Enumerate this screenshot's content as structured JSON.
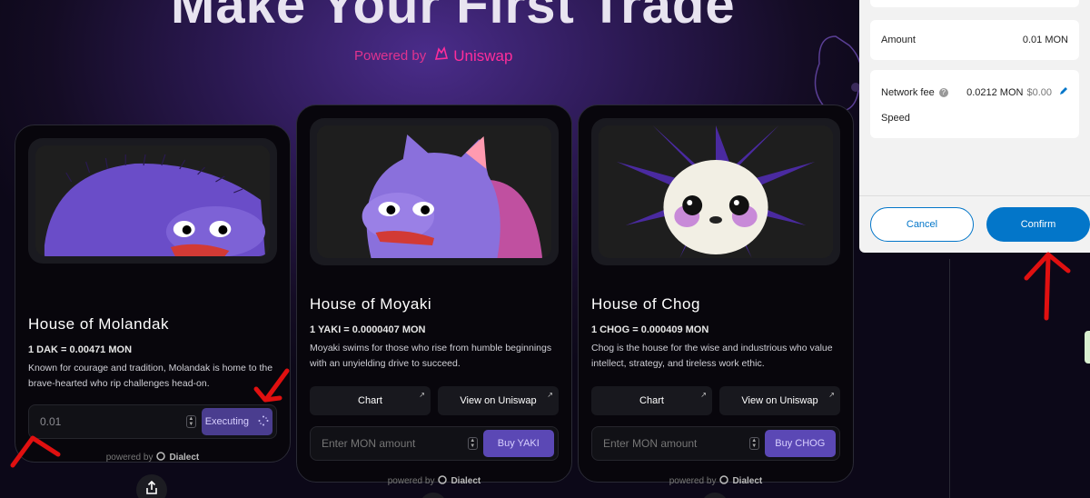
{
  "hero": {
    "title": "Make Your First Trade",
    "powered_prefix": "Powered by",
    "powered_brand": "Uniswap"
  },
  "cards": [
    {
      "name": "House of Molandak",
      "price": "1 DAK = 0.00471 MON",
      "description": "Known for courage and tradition, Molandak is home to the brave-hearted who rip challenges head-on.",
      "input_value": "0.01",
      "action_label": "Executing",
      "powered_prefix": "powered by",
      "powered_brand": "Dialect"
    },
    {
      "name": "House of Moyaki",
      "price": "1 YAKI = 0.0000407 MON",
      "description": "Moyaki swims for those who rise from humble beginnings with an unyielding drive to succeed.",
      "chart_label": "Chart",
      "uniswap_label": "View on Uniswap",
      "input_placeholder": "Enter MON amount",
      "action_label": "Buy YAKI",
      "powered_prefix": "powered by",
      "powered_brand": "Dialect"
    },
    {
      "name": "House of Chog",
      "price": "1 CHOG = 0.000409 MON",
      "description": "Chog is the house for the wise and industrious who value intellect, strategy, and tireless work ethic.",
      "chart_label": "Chart",
      "uniswap_label": "View on Uniswap",
      "input_placeholder": "Enter MON amount",
      "action_label": "Buy CHOG",
      "powered_prefix": "powered by",
      "powered_brand": "Dialect"
    }
  ],
  "wallet_modal": {
    "amount_label": "Amount",
    "amount_value": "0.01 MON",
    "network_fee_label": "Network fee",
    "network_fee_value": "0.0212 MON",
    "network_fee_fiat": "$0.00",
    "speed_label": "Speed",
    "cancel_label": "Cancel",
    "confirm_label": "Confirm"
  },
  "colors": {
    "accent_purple": "#5b48b5",
    "uniswap_pink": "#ff2d9b",
    "metamask_blue": "#0376c9",
    "annotation_red": "#e01010"
  }
}
